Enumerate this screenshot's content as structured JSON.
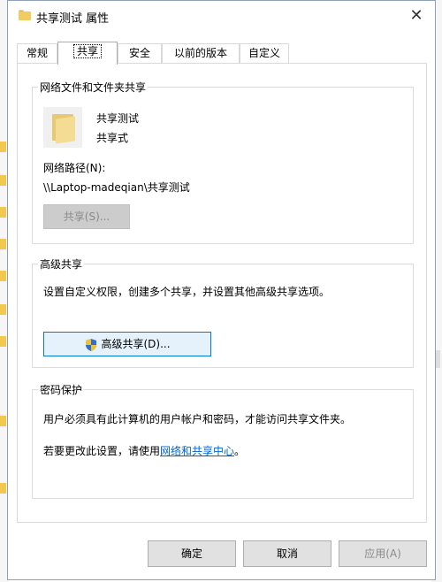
{
  "window": {
    "title": "共享测试 属性",
    "close_glyph": "✕"
  },
  "tabs": [
    {
      "label": "常规"
    },
    {
      "label": "共享"
    },
    {
      "label": "安全"
    },
    {
      "label": "以前的版本"
    },
    {
      "label": "自定义"
    }
  ],
  "network_share": {
    "group_label": "网络文件和文件夹共享",
    "folder_name": "共享测试",
    "share_state": "共享式",
    "path_label": "网络路径(N):",
    "path_value": "\\\\Laptop-madeqian\\共享测试",
    "share_button": "共享(S)..."
  },
  "advanced_share": {
    "group_label": "高级共享",
    "description": "设置自定义权限，创建多个共享，并设置其他高级共享选项。",
    "button": "高级共享(D)..."
  },
  "password_protection": {
    "group_label": "密码保护",
    "description": "用户必须具有此计算机的用户帐户和密码，才能访问共享文件夹。",
    "change_prefix": "若要更改此设置，请使用",
    "link": "网络和共享中心",
    "change_suffix": "。"
  },
  "footer": {
    "ok": "确定",
    "cancel": "取消",
    "apply": "应用(A)"
  },
  "icons": {
    "title": "folder-icon",
    "large": "folder-icon",
    "uac": "uac-shield-icon"
  },
  "colors": {
    "link": "#0066cc",
    "focus_border": "#0078d7",
    "folder": "#f3cc61"
  }
}
